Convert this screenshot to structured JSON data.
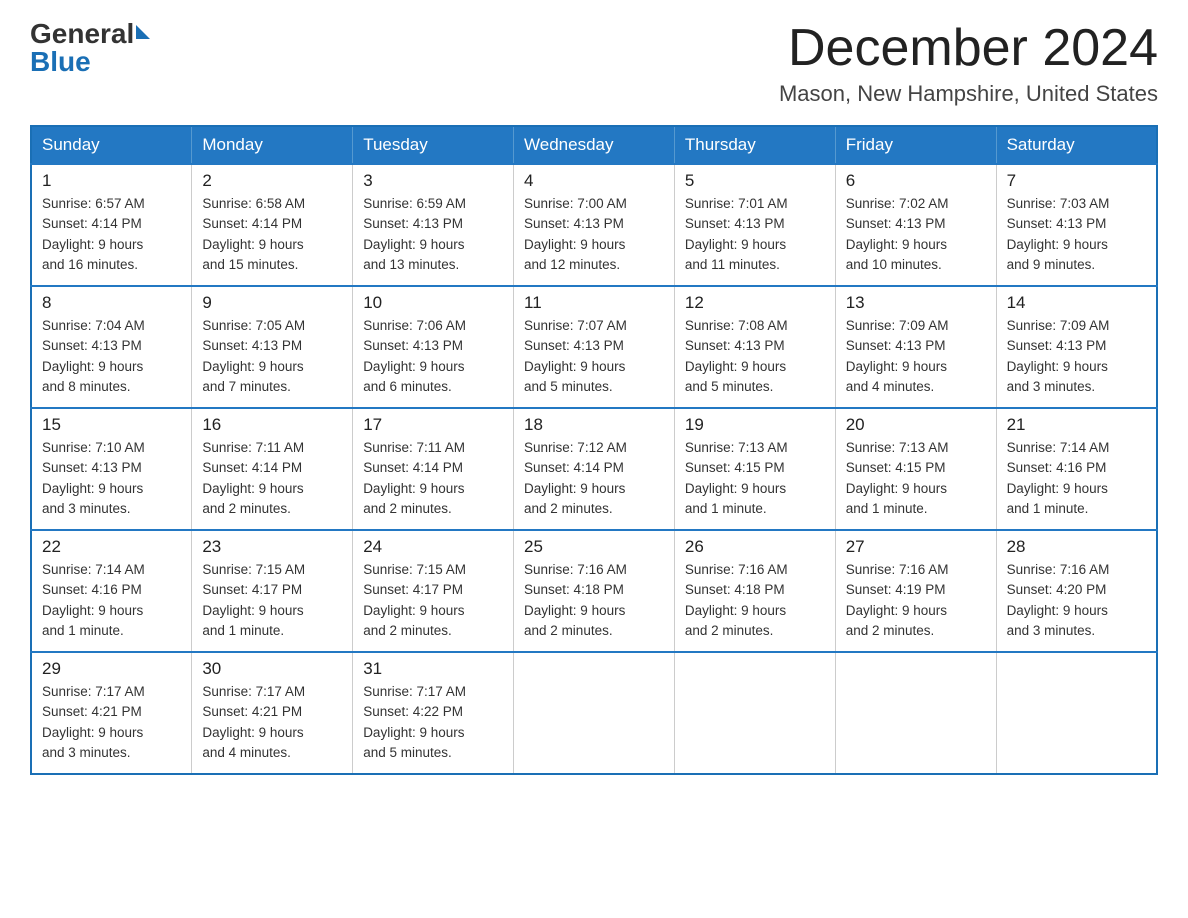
{
  "logo": {
    "general": "General",
    "blue": "Blue"
  },
  "title": "December 2024",
  "location": "Mason, New Hampshire, United States",
  "days_of_week": [
    "Sunday",
    "Monday",
    "Tuesday",
    "Wednesday",
    "Thursday",
    "Friday",
    "Saturday"
  ],
  "weeks": [
    [
      {
        "day": "1",
        "sunrise": "6:57 AM",
        "sunset": "4:14 PM",
        "daylight": "9 hours and 16 minutes."
      },
      {
        "day": "2",
        "sunrise": "6:58 AM",
        "sunset": "4:14 PM",
        "daylight": "9 hours and 15 minutes."
      },
      {
        "day": "3",
        "sunrise": "6:59 AM",
        "sunset": "4:13 PM",
        "daylight": "9 hours and 13 minutes."
      },
      {
        "day": "4",
        "sunrise": "7:00 AM",
        "sunset": "4:13 PM",
        "daylight": "9 hours and 12 minutes."
      },
      {
        "day": "5",
        "sunrise": "7:01 AM",
        "sunset": "4:13 PM",
        "daylight": "9 hours and 11 minutes."
      },
      {
        "day": "6",
        "sunrise": "7:02 AM",
        "sunset": "4:13 PM",
        "daylight": "9 hours and 10 minutes."
      },
      {
        "day": "7",
        "sunrise": "7:03 AM",
        "sunset": "4:13 PM",
        "daylight": "9 hours and 9 minutes."
      }
    ],
    [
      {
        "day": "8",
        "sunrise": "7:04 AM",
        "sunset": "4:13 PM",
        "daylight": "9 hours and 8 minutes."
      },
      {
        "day": "9",
        "sunrise": "7:05 AM",
        "sunset": "4:13 PM",
        "daylight": "9 hours and 7 minutes."
      },
      {
        "day": "10",
        "sunrise": "7:06 AM",
        "sunset": "4:13 PM",
        "daylight": "9 hours and 6 minutes."
      },
      {
        "day": "11",
        "sunrise": "7:07 AM",
        "sunset": "4:13 PM",
        "daylight": "9 hours and 5 minutes."
      },
      {
        "day": "12",
        "sunrise": "7:08 AM",
        "sunset": "4:13 PM",
        "daylight": "9 hours and 5 minutes."
      },
      {
        "day": "13",
        "sunrise": "7:09 AM",
        "sunset": "4:13 PM",
        "daylight": "9 hours and 4 minutes."
      },
      {
        "day": "14",
        "sunrise": "7:09 AM",
        "sunset": "4:13 PM",
        "daylight": "9 hours and 3 minutes."
      }
    ],
    [
      {
        "day": "15",
        "sunrise": "7:10 AM",
        "sunset": "4:13 PM",
        "daylight": "9 hours and 3 minutes."
      },
      {
        "day": "16",
        "sunrise": "7:11 AM",
        "sunset": "4:14 PM",
        "daylight": "9 hours and 2 minutes."
      },
      {
        "day": "17",
        "sunrise": "7:11 AM",
        "sunset": "4:14 PM",
        "daylight": "9 hours and 2 minutes."
      },
      {
        "day": "18",
        "sunrise": "7:12 AM",
        "sunset": "4:14 PM",
        "daylight": "9 hours and 2 minutes."
      },
      {
        "day": "19",
        "sunrise": "7:13 AM",
        "sunset": "4:15 PM",
        "daylight": "9 hours and 1 minute."
      },
      {
        "day": "20",
        "sunrise": "7:13 AM",
        "sunset": "4:15 PM",
        "daylight": "9 hours and 1 minute."
      },
      {
        "day": "21",
        "sunrise": "7:14 AM",
        "sunset": "4:16 PM",
        "daylight": "9 hours and 1 minute."
      }
    ],
    [
      {
        "day": "22",
        "sunrise": "7:14 AM",
        "sunset": "4:16 PM",
        "daylight": "9 hours and 1 minute."
      },
      {
        "day": "23",
        "sunrise": "7:15 AM",
        "sunset": "4:17 PM",
        "daylight": "9 hours and 1 minute."
      },
      {
        "day": "24",
        "sunrise": "7:15 AM",
        "sunset": "4:17 PM",
        "daylight": "9 hours and 2 minutes."
      },
      {
        "day": "25",
        "sunrise": "7:16 AM",
        "sunset": "4:18 PM",
        "daylight": "9 hours and 2 minutes."
      },
      {
        "day": "26",
        "sunrise": "7:16 AM",
        "sunset": "4:18 PM",
        "daylight": "9 hours and 2 minutes."
      },
      {
        "day": "27",
        "sunrise": "7:16 AM",
        "sunset": "4:19 PM",
        "daylight": "9 hours and 2 minutes."
      },
      {
        "day": "28",
        "sunrise": "7:16 AM",
        "sunset": "4:20 PM",
        "daylight": "9 hours and 3 minutes."
      }
    ],
    [
      {
        "day": "29",
        "sunrise": "7:17 AM",
        "sunset": "4:21 PM",
        "daylight": "9 hours and 3 minutes."
      },
      {
        "day": "30",
        "sunrise": "7:17 AM",
        "sunset": "4:21 PM",
        "daylight": "9 hours and 4 minutes."
      },
      {
        "day": "31",
        "sunrise": "7:17 AM",
        "sunset": "4:22 PM",
        "daylight": "9 hours and 5 minutes."
      },
      null,
      null,
      null,
      null
    ]
  ]
}
